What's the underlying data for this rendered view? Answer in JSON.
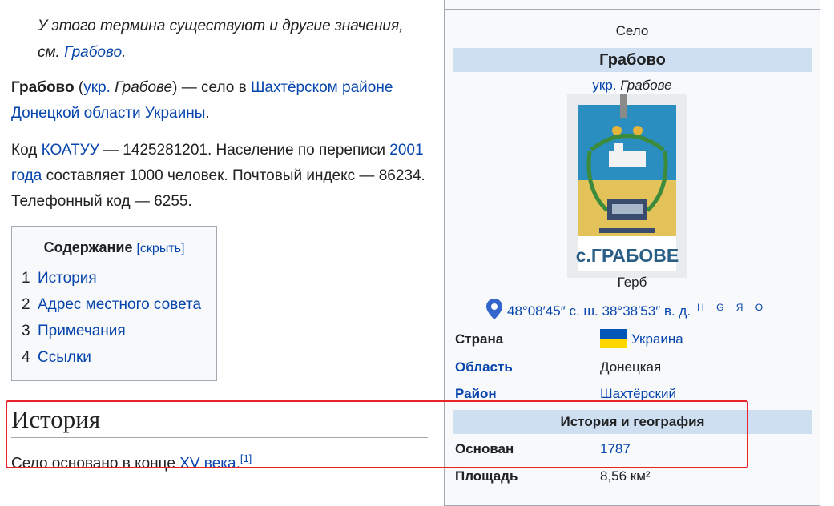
{
  "hatnote": {
    "text_before": "У этого термина существуют и другие значения, см. ",
    "link": "Грабово",
    "text_after": "."
  },
  "intro": {
    "title": "Грабово",
    "paren_open": " (",
    "ukr_label": "укр.",
    "ukr_name": "Грабове",
    "paren_close": ") — село в ",
    "district_link": "Шахтёрском районе",
    "space1": " ",
    "oblast_link": "Донецкой области",
    "space2": " ",
    "country_link": "Украины",
    "end": "."
  },
  "para2": {
    "t1": "Код ",
    "koatuu_link": "КОАТУУ",
    "t2": " — 1425281201. Население по переписи ",
    "census_link": "2001 года",
    "t3": " составляет 1000 человек. Почтовый индекс — 86234. Телефонный код — 6255."
  },
  "toc": {
    "title": "Содержание",
    "toggle": "[скрыть]",
    "items": [
      {
        "num": "1",
        "label": "История"
      },
      {
        "num": "2",
        "label": "Адрес местного совета"
      },
      {
        "num": "3",
        "label": "Примечания"
      },
      {
        "num": "4",
        "label": "Ссылки"
      }
    ]
  },
  "section": {
    "heading": "История",
    "text": "Село основано в конце ",
    "link": "XV века",
    "end": ".",
    "ref": "[1]"
  },
  "infobox": {
    "type": "Село",
    "title": "Грабово",
    "ukr_label": "укр.",
    "ukr_name": "Грабове",
    "coat_text": "с.ГРАБОВЕ",
    "coat_caption": "Герб",
    "coords": "48°08′45″ с. ш. 38°38′53″ в. д.",
    "maps": "H G Я O",
    "rows": [
      {
        "key": "Страна",
        "value": "Украина"
      },
      {
        "key": "Область",
        "value": "Донецкая"
      },
      {
        "key": "Район",
        "value": "Шахтёрский"
      }
    ],
    "section": "История и география",
    "rows2": [
      {
        "key": "Основан",
        "value": "1787"
      },
      {
        "key": "Площадь",
        "value": "8,56 км²"
      }
    ]
  },
  "colors": {
    "link": "#0645ad",
    "header_bg": "#cedff2",
    "highlight": "#e8232a",
    "flag_blue": "#0057b7",
    "flag_yellow": "#ffd700"
  }
}
